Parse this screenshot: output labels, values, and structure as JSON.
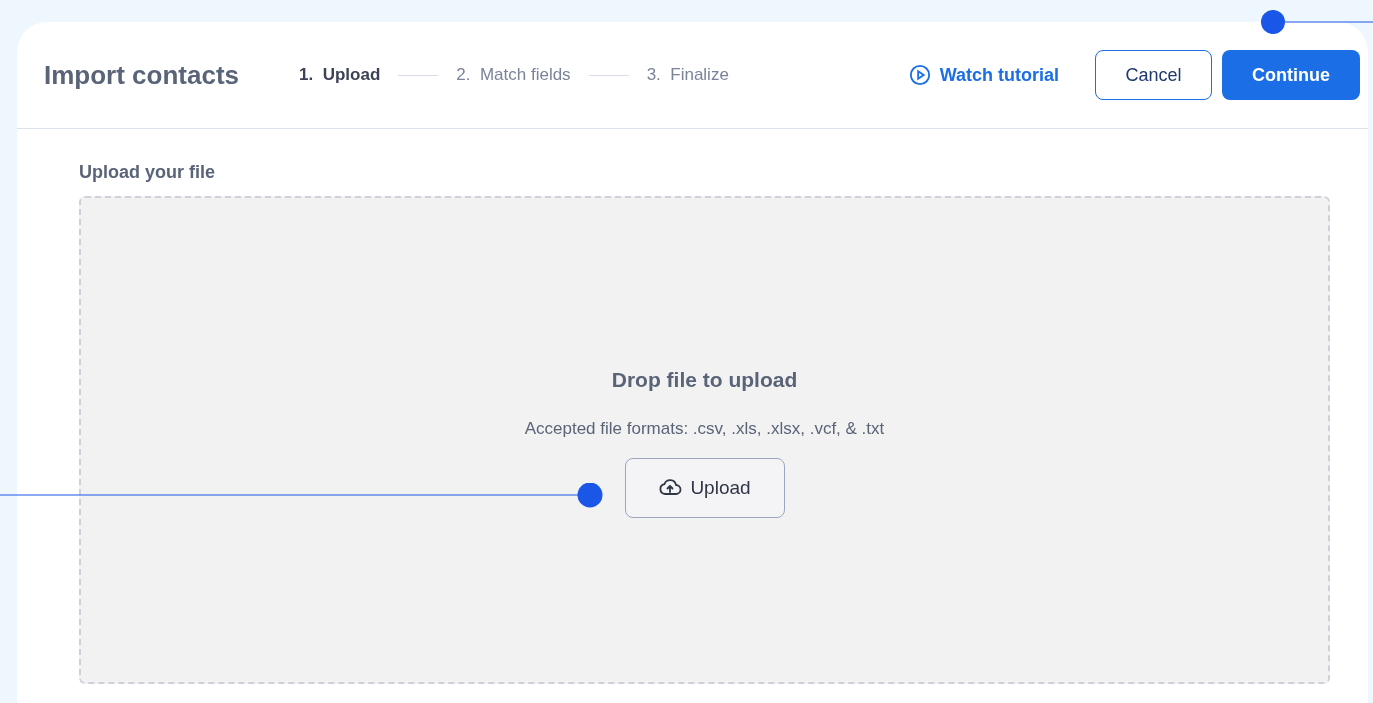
{
  "header": {
    "title": "Import contacts",
    "steps": [
      {
        "number": "1.",
        "label": "Upload",
        "selected": true
      },
      {
        "number": "2.",
        "label": "Match fields",
        "selected": false
      },
      {
        "number": "3.",
        "label": "Finalize",
        "selected": false
      }
    ],
    "tutorial_link": "Watch tutorial",
    "cancel_button": "Cancel",
    "continue_button": "Continue"
  },
  "upload": {
    "heading": "Upload your file",
    "drop_title": "Drop file to upload",
    "formats": "Accepted file formats: .csv, .xls, .xlsx, .vcf, & .txt",
    "button": "Upload"
  }
}
